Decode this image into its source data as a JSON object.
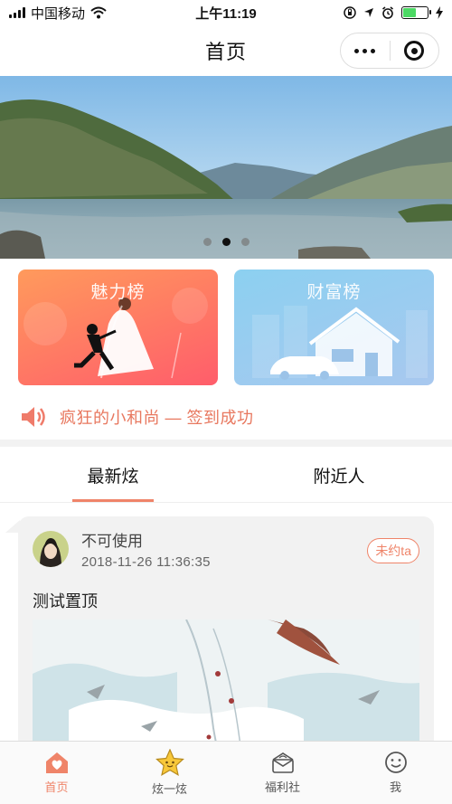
{
  "status_bar": {
    "carrier": "中国移动",
    "time": "上午11:19",
    "battery_level": 0.55
  },
  "header": {
    "title": "首页",
    "menu_icon": "more-dots-icon",
    "close_icon": "target-circle-icon"
  },
  "banner": {
    "slide_count": 3,
    "active_index": 1
  },
  "rank_cards": [
    {
      "label": "魅力榜",
      "icon": "proposal-couple-illustration"
    },
    {
      "label": "财富榜",
      "icon": "house-car-illustration"
    }
  ],
  "notice": {
    "icon": "speaker-icon",
    "text": "疯狂的小和尚 — 签到成功"
  },
  "tabs": [
    {
      "label": "最新炫",
      "active": true
    },
    {
      "label": "附近人",
      "active": false
    }
  ],
  "post": {
    "user": "不可使用",
    "time": "2018-11-26 11:36:35",
    "badge": "未约ta",
    "text": "测试置顶"
  },
  "bottom_nav": [
    {
      "label": "首页",
      "icon": "home-heart-icon",
      "active": true
    },
    {
      "label": "炫一炫",
      "icon": "star-icon",
      "active": false
    },
    {
      "label": "福利社",
      "icon": "gift-box-icon",
      "active": false
    },
    {
      "label": "我",
      "icon": "smiley-icon",
      "active": false
    }
  ],
  "colors": {
    "accent": "#ef8469",
    "charm_card_start": "#ff9a5c",
    "charm_card_end": "#ff5d6b",
    "wealth_card_start": "#8cd0f0",
    "wealth_card_end": "#a8c8ef"
  }
}
